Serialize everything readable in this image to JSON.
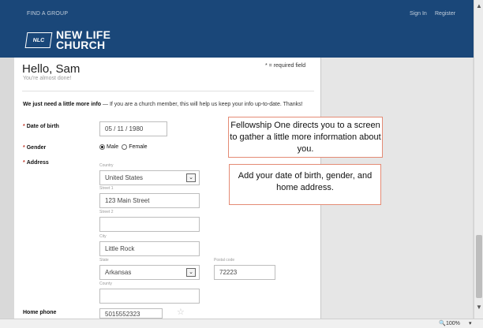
{
  "header": {
    "find_group": "FIND A GROUP",
    "sign_in": "Sign In",
    "register": "Register",
    "logo_mark": "NLC",
    "logo_line1": "NEW LIFE",
    "logo_line2": "CHURCH",
    "brand_color": "#1a4779"
  },
  "form": {
    "greeting": "Hello, Sam",
    "subgreeting": "You're almost done!",
    "required_note": "* = required field",
    "intro_bold": "We just need a little more info",
    "intro_rest": " — If you are a church member, this will help us keep your info up-to-date. Thanks!",
    "dob_label": "Date of birth",
    "dob_value": "05 / 11 / 1980",
    "gender_label": "Gender",
    "gender_male": "Male",
    "gender_female": "Female",
    "gender_selected": "Male",
    "address_label": "Address",
    "country_label": "Country",
    "country_value": "United States",
    "street1_label": "Street 1",
    "street1_value": "123 Main Street",
    "street2_label": "Street 2",
    "street2_value": "",
    "city_label": "City",
    "city_value": "Little Rock",
    "state_label": "State",
    "state_value": "Arkansas",
    "postal_label": "Postal code",
    "postal_value": "72223",
    "county_label": "County",
    "county_value": "",
    "phone_label": "Home phone",
    "phone_value": "5015552323"
  },
  "callouts": {
    "first": "Fellowship One directs you to a screen to gather a little more information about you.",
    "second": "Add your date of birth, gender, and home address."
  },
  "status": {
    "zoom": "100%"
  }
}
